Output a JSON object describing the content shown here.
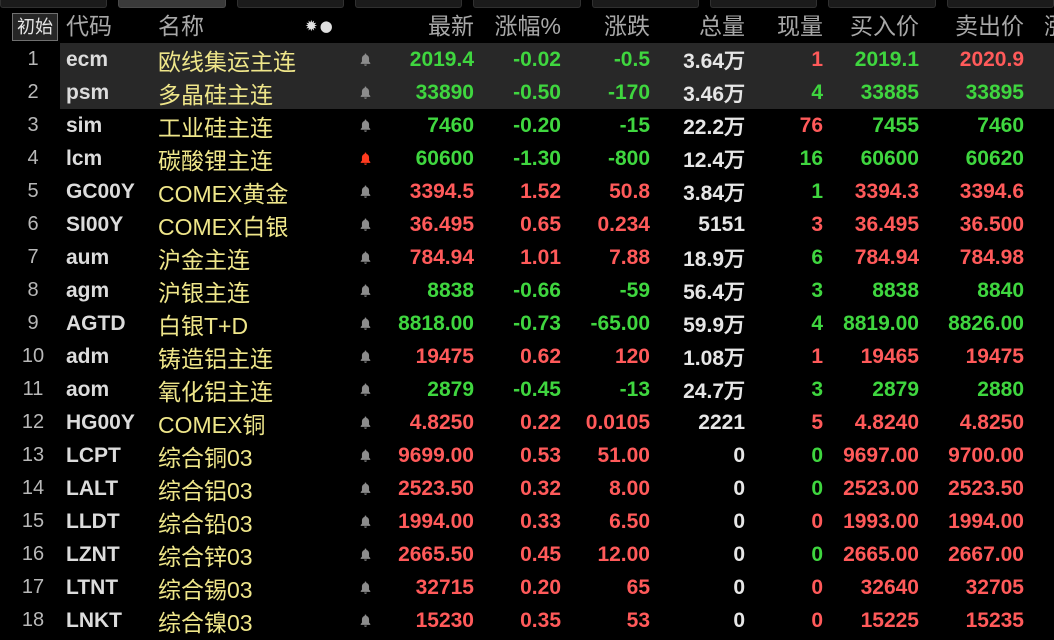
{
  "header": {
    "reset_button": "初始",
    "columns": {
      "code": "代码",
      "name": "名称",
      "latest": "最新",
      "change_pct": "涨幅%",
      "change": "涨跌",
      "volume": "总量",
      "current_volume": "现量",
      "bid": "买入价",
      "ask": "卖出价",
      "cut_off": "涨"
    }
  },
  "icons": {
    "alert": "bell-icon",
    "header_left": "sun-icon",
    "header_right": "dot-icon"
  },
  "colors": {
    "up": "#ff5a5a",
    "down": "#3fd63f",
    "flat": "#e6e6e6",
    "name": "#efe68a",
    "code": "#dcdcdc",
    "index": "#b8b8b8",
    "header": "#a8a8a8",
    "bell": "#8c8c8c",
    "bell_active": "#ff3b1f",
    "background": "#000000",
    "selected_row": "#282828"
  },
  "rows": [
    {
      "no": "1",
      "code": "ecm",
      "name": "欧线集运主连",
      "latest": "2019.4",
      "pct": "-0.02",
      "chg": "-0.5",
      "vol": "3.64万",
      "cur": "1",
      "bid": "2019.1",
      "ask": "2020.9",
      "up": false,
      "cur_up": true,
      "bid_up": false,
      "ask_up": true,
      "alert_active": false,
      "selected": true
    },
    {
      "no": "2",
      "code": "psm",
      "name": "多晶硅主连",
      "latest": "33890",
      "pct": "-0.50",
      "chg": "-170",
      "vol": "3.46万",
      "cur": "4",
      "bid": "33885",
      "ask": "33895",
      "up": false,
      "cur_up": false,
      "bid_up": false,
      "ask_up": false,
      "alert_active": false,
      "selected": true
    },
    {
      "no": "3",
      "code": "sim",
      "name": "工业硅主连",
      "latest": "7460",
      "pct": "-0.20",
      "chg": "-15",
      "vol": "22.2万",
      "cur": "76",
      "bid": "7455",
      "ask": "7460",
      "up": false,
      "cur_up": true,
      "bid_up": false,
      "ask_up": false,
      "alert_active": false,
      "selected": false
    },
    {
      "no": "4",
      "code": "lcm",
      "name": "碳酸锂主连",
      "latest": "60600",
      "pct": "-1.30",
      "chg": "-800",
      "vol": "12.4万",
      "cur": "16",
      "bid": "60600",
      "ask": "60620",
      "up": false,
      "cur_up": false,
      "bid_up": false,
      "ask_up": false,
      "alert_active": true,
      "selected": false
    },
    {
      "no": "5",
      "code": "GC00Y",
      "name": "COMEX黄金",
      "latest": "3394.5",
      "pct": "1.52",
      "chg": "50.8",
      "vol": "3.84万",
      "cur": "1",
      "bid": "3394.3",
      "ask": "3394.6",
      "up": true,
      "cur_up": false,
      "bid_up": true,
      "ask_up": true,
      "alert_active": false,
      "selected": false
    },
    {
      "no": "6",
      "code": "SI00Y",
      "name": "COMEX白银",
      "latest": "36.495",
      "pct": "0.65",
      "chg": "0.234",
      "vol": "5151",
      "cur": "3",
      "bid": "36.495",
      "ask": "36.500",
      "up": true,
      "cur_up": true,
      "bid_up": true,
      "ask_up": true,
      "alert_active": false,
      "selected": false
    },
    {
      "no": "7",
      "code": "aum",
      "name": "沪金主连",
      "latest": "784.94",
      "pct": "1.01",
      "chg": "7.88",
      "vol": "18.9万",
      "cur": "6",
      "bid": "784.94",
      "ask": "784.98",
      "up": true,
      "cur_up": false,
      "bid_up": true,
      "ask_up": true,
      "alert_active": false,
      "selected": false
    },
    {
      "no": "8",
      "code": "agm",
      "name": "沪银主连",
      "latest": "8838",
      "pct": "-0.66",
      "chg": "-59",
      "vol": "56.4万",
      "cur": "3",
      "bid": "8838",
      "ask": "8840",
      "up": false,
      "cur_up": false,
      "bid_up": false,
      "ask_up": false,
      "alert_active": false,
      "selected": false
    },
    {
      "no": "9",
      "code": "AGTD",
      "name": "白银T+D",
      "latest": "8818.00",
      "pct": "-0.73",
      "chg": "-65.00",
      "vol": "59.9万",
      "cur": "4",
      "bid": "8819.00",
      "ask": "8826.00",
      "up": false,
      "cur_up": false,
      "bid_up": false,
      "ask_up": false,
      "alert_active": false,
      "selected": false
    },
    {
      "no": "10",
      "code": "adm",
      "name": "铸造铝主连",
      "latest": "19475",
      "pct": "0.62",
      "chg": "120",
      "vol": "1.08万",
      "cur": "1",
      "bid": "19465",
      "ask": "19475",
      "up": true,
      "cur_up": true,
      "bid_up": true,
      "ask_up": true,
      "alert_active": false,
      "selected": false
    },
    {
      "no": "11",
      "code": "aom",
      "name": "氧化铝主连",
      "latest": "2879",
      "pct": "-0.45",
      "chg": "-13",
      "vol": "24.7万",
      "cur": "3",
      "bid": "2879",
      "ask": "2880",
      "up": false,
      "cur_up": false,
      "bid_up": false,
      "ask_up": false,
      "alert_active": false,
      "selected": false
    },
    {
      "no": "12",
      "code": "HG00Y",
      "name": "COMEX铜",
      "latest": "4.8250",
      "pct": "0.22",
      "chg": "0.0105",
      "vol": "2221",
      "cur": "5",
      "bid": "4.8240",
      "ask": "4.8250",
      "up": true,
      "cur_up": true,
      "bid_up": true,
      "ask_up": true,
      "alert_active": false,
      "selected": false
    },
    {
      "no": "13",
      "code": "LCPT",
      "name": "综合铜03",
      "latest": "9699.00",
      "pct": "0.53",
      "chg": "51.00",
      "vol": "0",
      "cur": "0",
      "bid": "9697.00",
      "ask": "9700.00",
      "up": true,
      "cur_up": false,
      "bid_up": true,
      "ask_up": true,
      "alert_active": false,
      "selected": false
    },
    {
      "no": "14",
      "code": "LALT",
      "name": "综合铝03",
      "latest": "2523.50",
      "pct": "0.32",
      "chg": "8.00",
      "vol": "0",
      "cur": "0",
      "bid": "2523.00",
      "ask": "2523.50",
      "up": true,
      "cur_up": false,
      "bid_up": true,
      "ask_up": true,
      "alert_active": false,
      "selected": false
    },
    {
      "no": "15",
      "code": "LLDT",
      "name": "综合铅03",
      "latest": "1994.00",
      "pct": "0.33",
      "chg": "6.50",
      "vol": "0",
      "cur": "0",
      "bid": "1993.00",
      "ask": "1994.00",
      "up": true,
      "cur_up": true,
      "bid_up": true,
      "ask_up": true,
      "alert_active": false,
      "selected": false
    },
    {
      "no": "16",
      "code": "LZNT",
      "name": "综合锌03",
      "latest": "2665.50",
      "pct": "0.45",
      "chg": "12.00",
      "vol": "0",
      "cur": "0",
      "bid": "2665.00",
      "ask": "2667.00",
      "up": true,
      "cur_up": false,
      "bid_up": true,
      "ask_up": true,
      "alert_active": false,
      "selected": false
    },
    {
      "no": "17",
      "code": "LTNT",
      "name": "综合锡03",
      "latest": "32715",
      "pct": "0.20",
      "chg": "65",
      "vol": "0",
      "cur": "0",
      "bid": "32640",
      "ask": "32705",
      "up": true,
      "cur_up": true,
      "bid_up": true,
      "ask_up": true,
      "alert_active": false,
      "selected": false
    },
    {
      "no": "18",
      "code": "LNKT",
      "name": "综合镍03",
      "latest": "15230",
      "pct": "0.35",
      "chg": "53",
      "vol": "0",
      "cur": "0",
      "bid": "15225",
      "ask": "15235",
      "up": true,
      "cur_up": true,
      "bid_up": true,
      "ask_up": true,
      "alert_active": false,
      "selected": false
    }
  ]
}
